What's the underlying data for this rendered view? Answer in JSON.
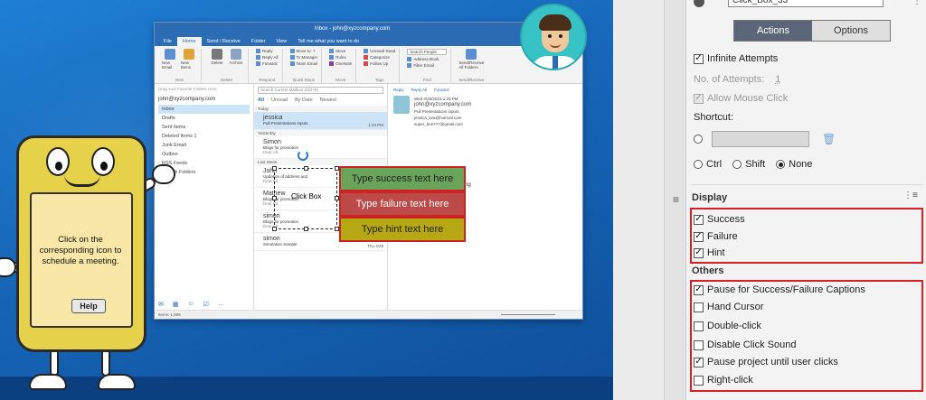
{
  "outlook": {
    "title": "Inbox - john@xyzcompany.com",
    "tell_me": "Tell me what you want to do",
    "menu_tabs": [
      "File",
      "Home",
      "Send / Receive",
      "Folder",
      "View"
    ],
    "ribbon": {
      "new_email": "New Email",
      "new_items": "New Items",
      "delete": "Delete",
      "archive": "Archive",
      "reply": "Reply",
      "reply_all": "Reply All",
      "forward": "Forward",
      "move_to": "Move to: ?",
      "to_manager": "To Manager",
      "team_email": "Team Email",
      "move": "Move",
      "rules": "Rules",
      "onenote": "OneNote",
      "unread_read": "Unread/ Read",
      "categorize": "Categorize",
      "follow_up": "Follow Up",
      "search_people": "Search People",
      "address_book": "Address Book",
      "filter_email": "Filter Email",
      "send_receive": "Send/Receive All Folders",
      "groups": [
        "New",
        "Delete",
        "Respond",
        "Quick Steps",
        "Move",
        "Tags",
        "Find",
        "Send/Receive"
      ]
    },
    "folders": {
      "drag_hint": "Drag Your Favorite Folders Here",
      "account": "john@xyzcompany.com",
      "items": [
        "Inbox",
        "Drafts",
        "Sent Items",
        "Deleted Items 1",
        "Junk Email",
        "Outbox",
        "RSS Feeds",
        "Search Folders"
      ]
    },
    "list": {
      "search_placeholder": "Search Current Mailbox (Ctrl+E)",
      "scope": "Current Mailbox",
      "tab_all": "All",
      "tab_unread": "Unread",
      "sort": "By Date",
      "order": "Newest",
      "group_today": "Today",
      "group_yesterday": "Yesterday",
      "group_last_week": "Last Week",
      "messages": [
        {
          "from": "jessica",
          "subject": "Pull Presentations inputs",
          "preview": "",
          "date": "1:23 PM"
        },
        {
          "from": "Simon",
          "subject": "Blogs for promotion",
          "preview": "Dear All,",
          "date": ""
        },
        {
          "from": "John",
          "subject": "Updation of address and",
          "preview": "Dear All,",
          "date": ""
        },
        {
          "from": "Mathew",
          "subject": "Blogs for promotion",
          "preview": "Dear All,",
          "date": "Thu 4/29"
        },
        {
          "from": "simon",
          "subject": "Blogs for promotion",
          "preview": "Dear All,",
          "date": "Thu 4/29"
        },
        {
          "from": "simon",
          "subject": "Simulation Sample",
          "preview": "",
          "date": "Thu 4/29"
        }
      ]
    },
    "reading": {
      "actions": [
        "Reply",
        "Reply All",
        "Forward"
      ],
      "date": "Wed 4/26/2016 1:23 PM",
      "sender": "john@xyzcompany.com",
      "subject": "Pull Presentations inputs",
      "to": "jessica_sea@hotmail.com",
      "cc": "super_bee777@gmail.com",
      "body_lines": [
        "mmy text which has no meaning",
        "milar to real text. Common",
        "num text include: - blind text -",
        "red text - placeholder text",
        "mock-content - filler text."
      ],
      "sign_off": "Regards,",
      "signature": "John"
    },
    "status": "Items: 1,595"
  },
  "captions": {
    "click_box": "Click Box",
    "success": "Type success text here",
    "failure": "Type failure text here",
    "hint": "Type hint text here"
  },
  "mascot": {
    "instruction": "Click on the corresponding icon to schedule a meeting.",
    "help": "Help"
  },
  "panel": {
    "object_name": "Click_Box_33",
    "tabs": {
      "actions": "Actions",
      "options": "Options"
    },
    "infinite_attempts": {
      "label": "Infinite Attempts",
      "checked": true
    },
    "no_of_attempts_label": "No. of Attempts:",
    "no_of_attempts_value": "1",
    "allow_mouse_click": {
      "label": "Allow Mouse Click",
      "checked": true,
      "disabled": true
    },
    "shortcut_label": "Shortcut:",
    "modifiers": [
      {
        "label": "Ctrl",
        "selected": false
      },
      {
        "label": "Shift",
        "selected": false
      },
      {
        "label": "None",
        "selected": true
      }
    ],
    "display_title": "Display",
    "display": [
      {
        "label": "Success",
        "checked": true
      },
      {
        "label": "Failure",
        "checked": true
      },
      {
        "label": "Hint",
        "checked": true
      }
    ],
    "others_title": "Others",
    "others": [
      {
        "label": "Pause for Success/Failure Captions",
        "checked": true
      },
      {
        "label": "Hand Cursor",
        "checked": false
      },
      {
        "label": "Double-click",
        "checked": false
      },
      {
        "label": "Disable Click Sound",
        "checked": false
      },
      {
        "label": "Pause project until user clicks",
        "checked": true
      },
      {
        "label": "Right-click",
        "checked": false
      }
    ],
    "highlight_color": "#d62020",
    "active_tab_color": "#5b6778"
  }
}
